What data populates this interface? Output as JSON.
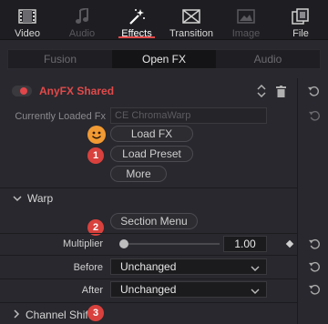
{
  "tabs": [
    {
      "label": "Video",
      "icon": "filmstrip-icon",
      "state": "normal"
    },
    {
      "label": "Audio",
      "icon": "music-note-icon",
      "state": "disabled"
    },
    {
      "label": "Effects",
      "icon": "magic-wand-icon",
      "state": "active"
    },
    {
      "label": "Transition",
      "icon": "transition-icon",
      "state": "normal"
    },
    {
      "label": "Image",
      "icon": "image-icon",
      "state": "disabled"
    },
    {
      "label": "File",
      "icon": "file-icon",
      "state": "normal"
    }
  ],
  "subtabs": [
    {
      "label": "Fusion",
      "active": false
    },
    {
      "label": "Open FX",
      "active": true
    },
    {
      "label": "Audio",
      "active": false
    }
  ],
  "fx": {
    "title": "AnyFX Shared",
    "currently_loaded_label": "Currently Loaded Fx",
    "currently_loaded_value": "CE ChromaWarp",
    "load_fx_label": "Load FX",
    "load_preset_label": "Load Preset",
    "more_label": "More"
  },
  "badges": [
    "1",
    "2",
    "3"
  ],
  "warp": {
    "title": "Warp",
    "section_menu_label": "Section Menu",
    "multiplier_label": "Multiplier",
    "multiplier_value": "1.00",
    "multiplier_fraction": 0.0,
    "before_label": "Before",
    "before_value": "Unchanged",
    "after_label": "After",
    "after_value": "Unchanged"
  },
  "channel_shift": {
    "title": "Channel Shift"
  },
  "colors": {
    "accent": "#e04a4a",
    "badge": "#d8413d",
    "smiley": "#f19a33",
    "panel_bg": "#28282e"
  }
}
